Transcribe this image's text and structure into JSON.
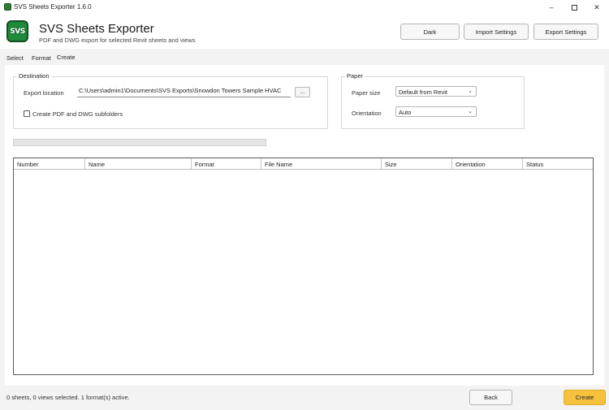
{
  "window": {
    "title": "SVS Sheets Exporter 1.6.0",
    "minimize_glyph": "–",
    "close_glyph": "✕"
  },
  "header": {
    "logo_text": "SVS",
    "app_name": "SVS Sheets Exporter",
    "subtitle": "PDF and DWG export for selected Revit sheets and views",
    "buttons": {
      "dark": "Dark",
      "import": "Import Settings",
      "export": "Export Settings"
    }
  },
  "tabs": [
    {
      "label": "Select"
    },
    {
      "label": "Format"
    },
    {
      "label": "Create",
      "active": true
    }
  ],
  "destination": {
    "title": "Destination",
    "export_location_label": "Export location",
    "export_location_value": "C:\\Users\\admin1\\Documents\\SVS Exports\\Snowdon Towers Sample HVAC",
    "browse_label": "...",
    "subfolders_label": "Create PDF and DWG subfolders",
    "subfolders_checked": false
  },
  "paper": {
    "title": "Paper",
    "size_label": "Paper size",
    "size_value": "Default from Revit",
    "orientation_label": "Orientation",
    "orientation_value": "Auto",
    "chevron_glyph": "⌄"
  },
  "progress": {
    "value": 0
  },
  "table": {
    "columns": [
      "Number",
      "Name",
      "Format",
      "File Name",
      "Size",
      "Orientation",
      "Status"
    ],
    "rows": []
  },
  "footer": {
    "status": "0 sheets, 0 views selected. 1 format(s) active.",
    "back_label": "Back",
    "create_label": "Create"
  },
  "colors": {
    "accent_create": "#f6c23e",
    "logo_green": "#1f8a3a"
  }
}
